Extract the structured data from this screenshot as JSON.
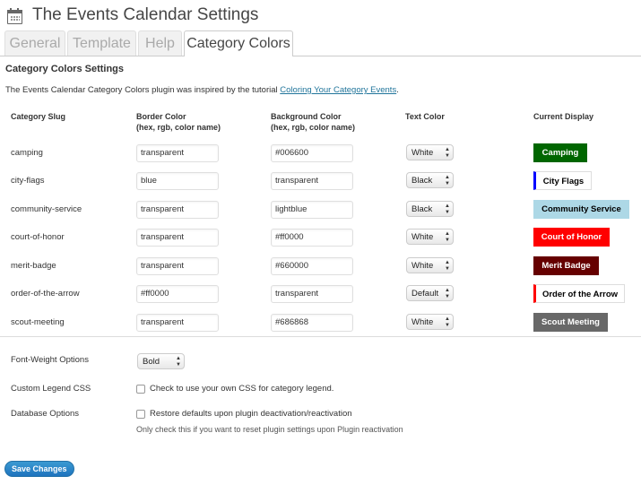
{
  "header": {
    "title": "The Events Calendar Settings",
    "icon": "calendar-icon"
  },
  "tabs": [
    {
      "label": "General",
      "active": false
    },
    {
      "label": "Template",
      "active": false
    },
    {
      "label": "Help",
      "active": false
    },
    {
      "label": "Category Colors",
      "active": true
    }
  ],
  "section": {
    "title": "Category Colors Settings",
    "intro_text": "The Events Calendar Category Colors plugin was inspired by the tutorial ",
    "intro_link": "Coloring Your Category Events",
    "intro_end": "."
  },
  "table": {
    "headers": {
      "slug": "Category Slug",
      "border": "Border Color",
      "border_sub": "(hex, rgb, color name)",
      "background": "Background Color",
      "background_sub": "(hex, rgb, color name)",
      "text": "Text Color",
      "display": "Current Display"
    },
    "rows": [
      {
        "slug": "camping",
        "border": "transparent",
        "background": "#006600",
        "text": "White",
        "display": "Camping",
        "bg_color": "#006600",
        "fg_color": "#ffffff",
        "border_color": "transparent"
      },
      {
        "slug": "city-flags",
        "border": "blue",
        "background": "transparent",
        "text": "Black",
        "display": "City Flags",
        "bg_color": "#ffffff",
        "fg_color": "#000000",
        "border_color": "#0000ff"
      },
      {
        "slug": "community-service",
        "border": "transparent",
        "background": "lightblue",
        "text": "Black",
        "display": "Community Service",
        "bg_color": "#add8e6",
        "fg_color": "#000000",
        "border_color": "transparent"
      },
      {
        "slug": "court-of-honor",
        "border": "transparent",
        "background": "#ff0000",
        "text": "White",
        "display": "Court of Honor",
        "bg_color": "#ff0000",
        "fg_color": "#ffffff",
        "border_color": "transparent"
      },
      {
        "slug": "merit-badge",
        "border": "transparent",
        "background": "#660000",
        "text": "White",
        "display": "Merit Badge",
        "bg_color": "#660000",
        "fg_color": "#ffffff",
        "border_color": "transparent"
      },
      {
        "slug": "order-of-the-arrow",
        "border": "#ff0000",
        "background": "transparent",
        "text": "Default",
        "display": "Order of the Arrow",
        "bg_color": "#ffffff",
        "fg_color": "#000000",
        "border_color": "#ff0000"
      },
      {
        "slug": "scout-meeting",
        "border": "transparent",
        "background": "#686868",
        "text": "White",
        "display": "Scout Meeting",
        "bg_color": "#686868",
        "fg_color": "#ffffff",
        "border_color": "transparent"
      }
    ]
  },
  "options": {
    "font_weight_label": "Font-Weight Options",
    "font_weight_value": "Bold",
    "legend_label": "Custom Legend CSS",
    "legend_checkbox": "Check to use your own CSS for category legend.",
    "db_label": "Database Options",
    "db_checkbox": "Restore defaults upon plugin deactivation/reactivation",
    "db_hint": "Only check this if you want to reset plugin settings upon Plugin reactivation"
  },
  "save_button": "Save Changes",
  "colors": {
    "link": "#21759b",
    "button": "#1e73be"
  }
}
